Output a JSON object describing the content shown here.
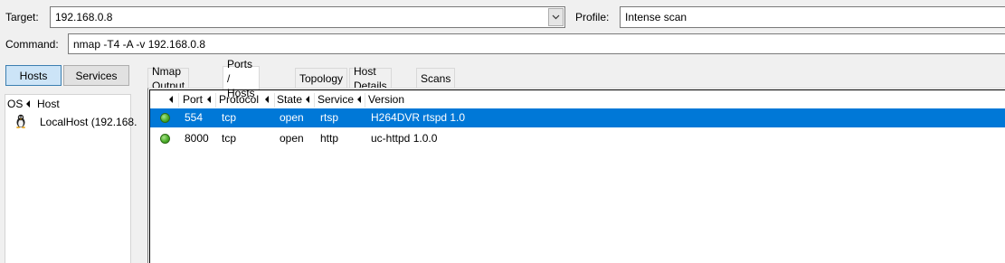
{
  "target": {
    "label": "Target:",
    "value": "192.168.0.8"
  },
  "profile": {
    "label": "Profile:",
    "value": "Intense scan"
  },
  "command": {
    "label": "Command:",
    "value": "nmap -T4 -A -v 192.168.0.8"
  },
  "toggle": {
    "hosts": "Hosts",
    "services": "Services",
    "active": "hosts"
  },
  "host_list": {
    "columns": {
      "os": "OS",
      "host": "Host"
    },
    "items": [
      {
        "os_icon": "linux-tux-icon",
        "name": "LocalHost (192.168."
      }
    ]
  },
  "tabs": [
    {
      "label": "Nmap Output"
    },
    {
      "label": "Ports / Hosts",
      "active": true
    },
    {
      "label": "Topology"
    },
    {
      "label": "Host Details"
    },
    {
      "label": "Scans"
    }
  ],
  "ports_table": {
    "columns": {
      "port": "Port",
      "protocol": "Protocol",
      "state": "State",
      "service": "Service",
      "version": "Version"
    },
    "rows": [
      {
        "status": "open",
        "port": "554",
        "protocol": "tcp",
        "state": "open",
        "service": "rtsp",
        "version": "H264DVR rtspd 1.0",
        "selected": true
      },
      {
        "status": "open",
        "port": "8000",
        "protocol": "tcp",
        "state": "open",
        "service": "http",
        "version": "uc-httpd 1.0.0",
        "selected": false
      }
    ]
  },
  "colors": {
    "selection": "#0078d7",
    "status_open": "#4caf2a"
  }
}
